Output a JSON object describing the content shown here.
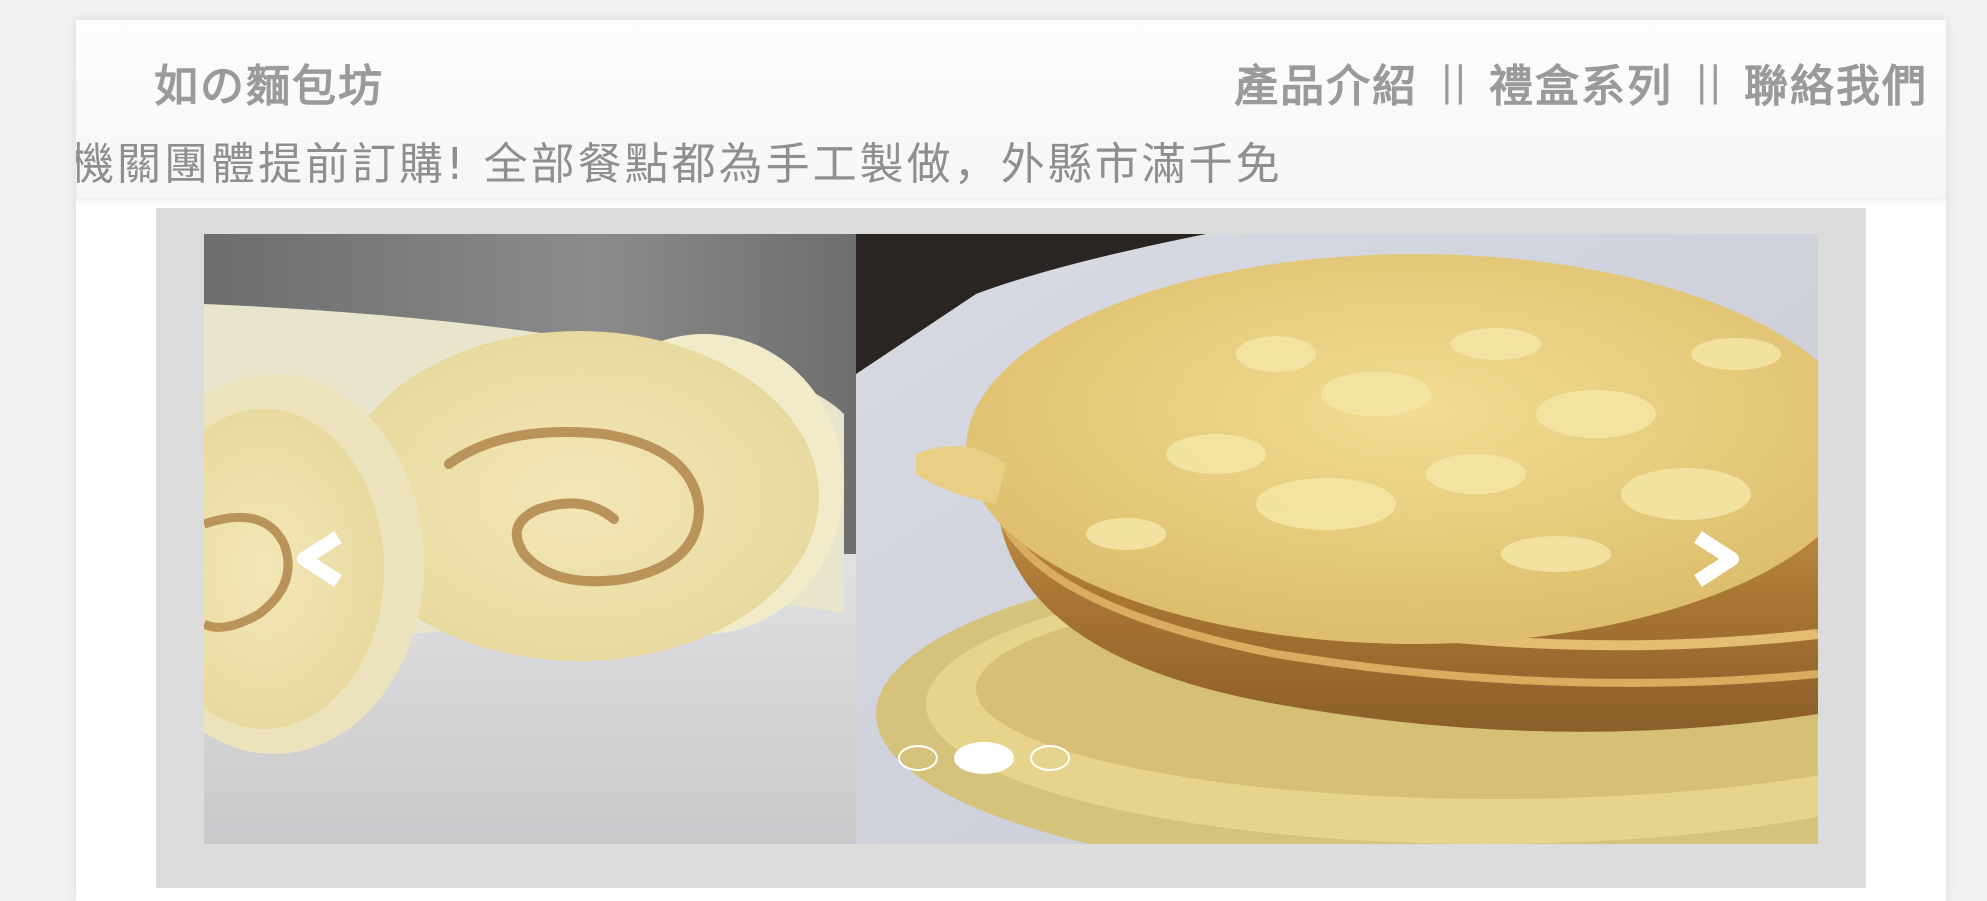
{
  "header": {
    "logo": "如の麵包坊",
    "nav": [
      {
        "label": "產品介紹"
      },
      {
        "label": "禮盒系列"
      },
      {
        "label": "聯絡我們"
      }
    ],
    "separator": "||"
  },
  "announcement": {
    "text": "機關團體提前訂購! 全部餐點都為手工製做，外縣市滿千免"
  },
  "carousel": {
    "slide_count": 3,
    "active_index": 1
  },
  "colors": {
    "header_text": "#9a9a9a",
    "frame": "#dcdcdc",
    "indicator": "#ffffff"
  }
}
